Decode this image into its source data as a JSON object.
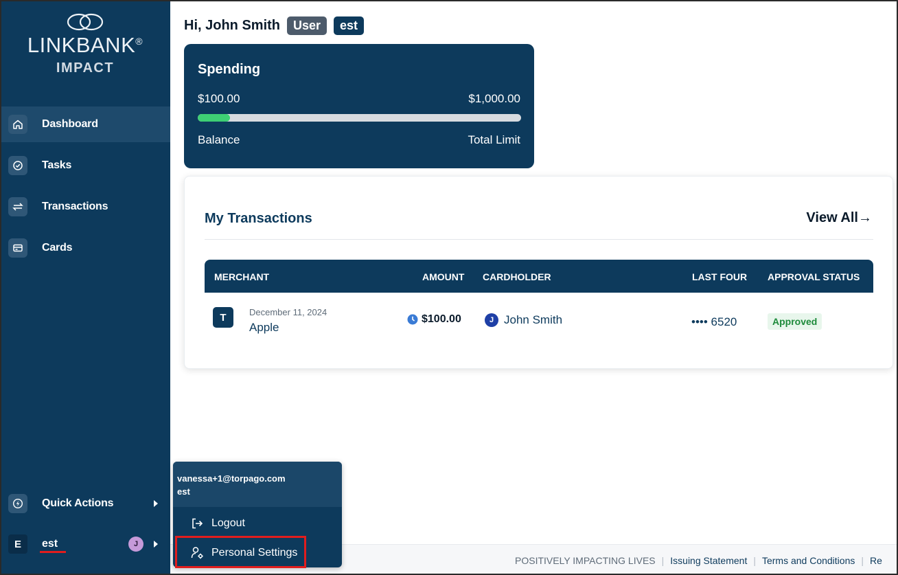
{
  "brand": {
    "name": "LINKBANK",
    "registered": "®",
    "sub": "IMPACT"
  },
  "sidebar": {
    "items": [
      {
        "label": "Dashboard",
        "icon": "home-icon",
        "active": true
      },
      {
        "label": "Tasks",
        "icon": "check-circle-icon"
      },
      {
        "label": "Transactions",
        "icon": "transfer-arrows-icon"
      },
      {
        "label": "Cards",
        "icon": "credit-card-icon"
      }
    ],
    "quick_actions": {
      "label": "Quick Actions",
      "icon": "lightning-icon"
    },
    "user": {
      "initial": "E",
      "name": "est",
      "avatar_initial": "J"
    }
  },
  "greeting": {
    "text": "Hi, John Smith",
    "role_badge": "User",
    "org_badge": "est"
  },
  "spending": {
    "title": "Spending",
    "balance": "$100.00",
    "limit": "$1,000.00",
    "balance_label": "Balance",
    "limit_label": "Total Limit",
    "progress_fraction": 0.1
  },
  "transactions": {
    "title": "My Transactions",
    "view_all": "View All",
    "columns": {
      "merchant": "MERCHANT",
      "amount": "AMOUNT",
      "cardholder": "CARDHOLDER",
      "last_four": "LAST FOUR",
      "approval_status": "APPROVAL STATUS"
    },
    "rows": [
      {
        "merchant_initial": "T",
        "date": "December 11, 2024",
        "merchant": "Apple",
        "amount": "$100.00",
        "cardholder_initial": "J",
        "cardholder": "John Smith",
        "last_four": "•••• 6520",
        "status": "Approved"
      }
    ]
  },
  "footer": {
    "tagline": "POSITIVELY IMPACTING LIVES",
    "links": [
      "Issuing Statement",
      "Terms and Conditions",
      "Re"
    ]
  },
  "dropdown": {
    "email": "vanessa+1@torpago.com",
    "org": "est",
    "items": [
      {
        "label": "Logout",
        "icon": "logout-icon"
      },
      {
        "label": "Personal Settings",
        "icon": "user-settings-icon"
      }
    ]
  },
  "colors": {
    "primary": "#0d3a5c",
    "progress": "#3ecf74",
    "approved": "#1d8a3a",
    "highlight": "#e11d1d"
  }
}
